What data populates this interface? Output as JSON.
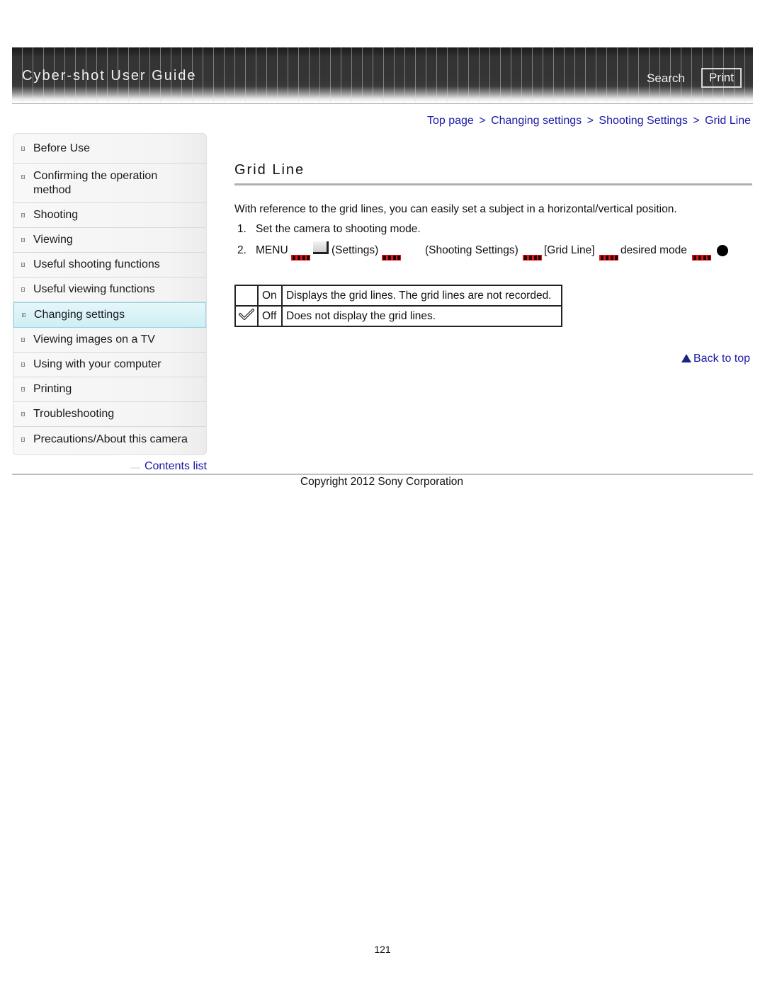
{
  "header": {
    "app_title": "Cyber-shot User Guide",
    "search_label": "Search",
    "print_label": "Print"
  },
  "breadcrumb": {
    "items": [
      "Top page",
      "Changing settings",
      "Shooting Settings",
      "Grid Line"
    ],
    "separator": ">"
  },
  "sidebar": {
    "items": [
      {
        "label": "Before Use",
        "active": false
      },
      {
        "label": "Confirming the operation method",
        "active": false
      },
      {
        "label": "Shooting",
        "active": false
      },
      {
        "label": "Viewing",
        "active": false
      },
      {
        "label": "Useful shooting functions",
        "active": false
      },
      {
        "label": "Useful viewing functions",
        "active": false
      },
      {
        "label": "Changing settings",
        "active": true
      },
      {
        "label": "Viewing images on a TV",
        "active": false
      },
      {
        "label": "Using with your computer",
        "active": false
      },
      {
        "label": "Printing",
        "active": false
      },
      {
        "label": "Troubleshooting",
        "active": false
      },
      {
        "label": "Precautions/About this camera",
        "active": false
      }
    ],
    "contents_link": "Contents list"
  },
  "main": {
    "title": "Grid Line",
    "intro": "With reference to the grid lines, you can easily set a subject in a horizontal/vertical position.",
    "steps": [
      {
        "num": "1.",
        "text": "Set the camera to shooting mode."
      },
      {
        "num": "2.",
        "parts": [
          "MENU",
          "(Settings)",
          "(Shooting Settings)",
          "[Grid Line]",
          "desired mode"
        ]
      }
    ],
    "icons": {
      "key": "arrow-key-icon",
      "settings": "settings-icon",
      "center_button": "center-button-icon",
      "default_check": "checkmark-icon",
      "back_top": "triangle-up-icon"
    },
    "options_table": [
      {
        "default": false,
        "value": "On",
        "description": "Displays the grid lines. The grid lines are not recorded."
      },
      {
        "default": true,
        "value": "Off",
        "description": "Does not display the grid lines."
      }
    ],
    "back_to_top": "Back to top"
  },
  "footer": {
    "copyright": "Copyright 2012 Sony Corporation",
    "page_number": "121"
  },
  "colors": {
    "link": "#1a1aa6",
    "active_nav": "#cfeef4",
    "key_icon": "#e8121a"
  }
}
